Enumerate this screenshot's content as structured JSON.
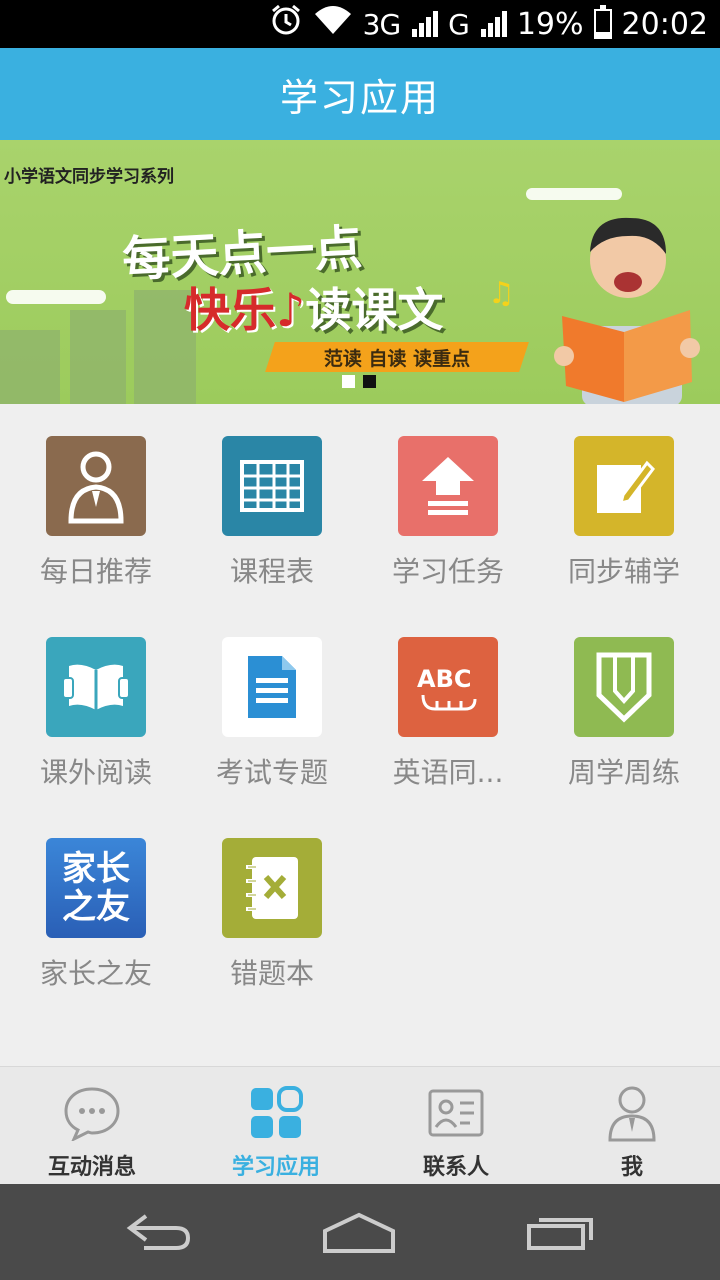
{
  "status_bar": {
    "network_1": "3G",
    "network_2": "G",
    "battery": "19%",
    "battery_fraction": 0.19,
    "time": "20:02",
    "icons": [
      "alarm-icon",
      "wifi-icon",
      "signal-icon",
      "battery-icon"
    ]
  },
  "header": {
    "title": "学习应用"
  },
  "banner": {
    "series": "小学语文同步学习系列",
    "headline_1": "每天点一点",
    "headline_2_a": "快乐",
    "headline_2_b": "读课文",
    "ribbon": "范读  自读  读重点",
    "page_count": 2,
    "active_page": 2
  },
  "apps": [
    {
      "label": "每日推荐",
      "icon": "person-icon",
      "color": "#8a6a4e"
    },
    {
      "label": "课程表",
      "icon": "timetable-icon",
      "color": "#2a86a6"
    },
    {
      "label": "学习任务",
      "icon": "upload-arrow-icon",
      "color": "#e8706a"
    },
    {
      "label": "同步辅学",
      "icon": "note-edit-icon",
      "color": "#d4b52a"
    },
    {
      "label": "课外阅读",
      "icon": "open-book-icon",
      "color": "#3aa6bc"
    },
    {
      "label": "考试专题",
      "icon": "document-icon",
      "color": "#ffffff"
    },
    {
      "label": "英语同...",
      "icon": "abc-icon",
      "color": "#dd6240"
    },
    {
      "label": "周学周练",
      "icon": "pencil-icon",
      "color": "#8fba52"
    },
    {
      "label": "家长之友",
      "icon": "parents-friend-logo",
      "color": "#2f6fc4",
      "logo_text_1": "家长",
      "logo_text_2": "之友"
    },
    {
      "label": "错题本",
      "icon": "wrong-answer-book-icon",
      "color": "#a4ad38"
    }
  ],
  "bottom_nav": {
    "items": [
      {
        "label": "互动消息",
        "icon": "chat-bubble-icon",
        "active": false
      },
      {
        "label": "学习应用",
        "icon": "apps-grid-icon",
        "active": true
      },
      {
        "label": "联系人",
        "icon": "contact-card-icon",
        "active": false
      },
      {
        "label": "我",
        "icon": "user-icon",
        "active": false
      }
    ],
    "active_color": "#3ab0e0"
  },
  "system_nav": {
    "icons": [
      "back-icon",
      "home-icon",
      "recent-apps-icon"
    ]
  }
}
